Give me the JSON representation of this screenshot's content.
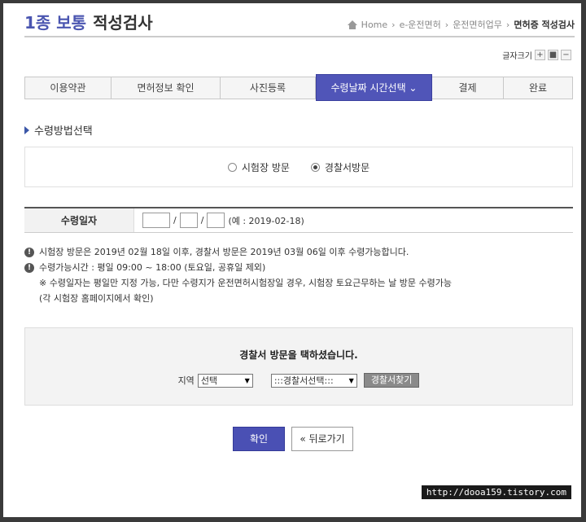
{
  "header": {
    "title_part1": "1종 보통",
    "title_part2": "적성검사",
    "breadcrumb": [
      "Home",
      "e-운전면허",
      "운전면허업무",
      "면허증 적성검사"
    ]
  },
  "font_size": {
    "label": "글자크기",
    "buttons": [
      "+",
      "■",
      "−"
    ]
  },
  "steps": {
    "items": [
      "이용약관",
      "면허정보 확인",
      "사진등록",
      "수령날짜 시간선택 ⌄",
      "결제",
      "완료"
    ],
    "active_index": 3
  },
  "method": {
    "section_title": "수령방법선택",
    "option1": "시험장 방문",
    "option2": "경찰서방문",
    "selected": "경찰서방문"
  },
  "date": {
    "label": "수령일자",
    "sep": "/",
    "example": "(예 : 2019-02-18)"
  },
  "notes": {
    "line1": "시험장 방문은 2019년 02월 18일 이후, 경찰서 방문은 2019년 03월 06일 이후 수령가능합니다.",
    "line2": "수령가능시간 : 평일 09:00 ~ 18:00 (토요일, 공휴일 제외)",
    "line3": "※ 수령일자는 평일만 지정 가능, 다만 수령지가 운전면허시험장일 경우, 시험장 토요근무하는 날 방문 수령가능",
    "line4": "(각 시험장 홈페이지에서 확인)"
  },
  "visit": {
    "title": "경찰서 방문을 택하셨습니다.",
    "region_label": "지역",
    "region_value": "선택",
    "station_value": ":::경찰서선택:::",
    "find_button": "경찰서찾기"
  },
  "actions": {
    "confirm": "확인",
    "back": "« 뒤로가기"
  },
  "watermark": "http://dooa159.tistory.com",
  "colors": {
    "accent": "#5055b8",
    "title_blue": "#4a55b0"
  }
}
